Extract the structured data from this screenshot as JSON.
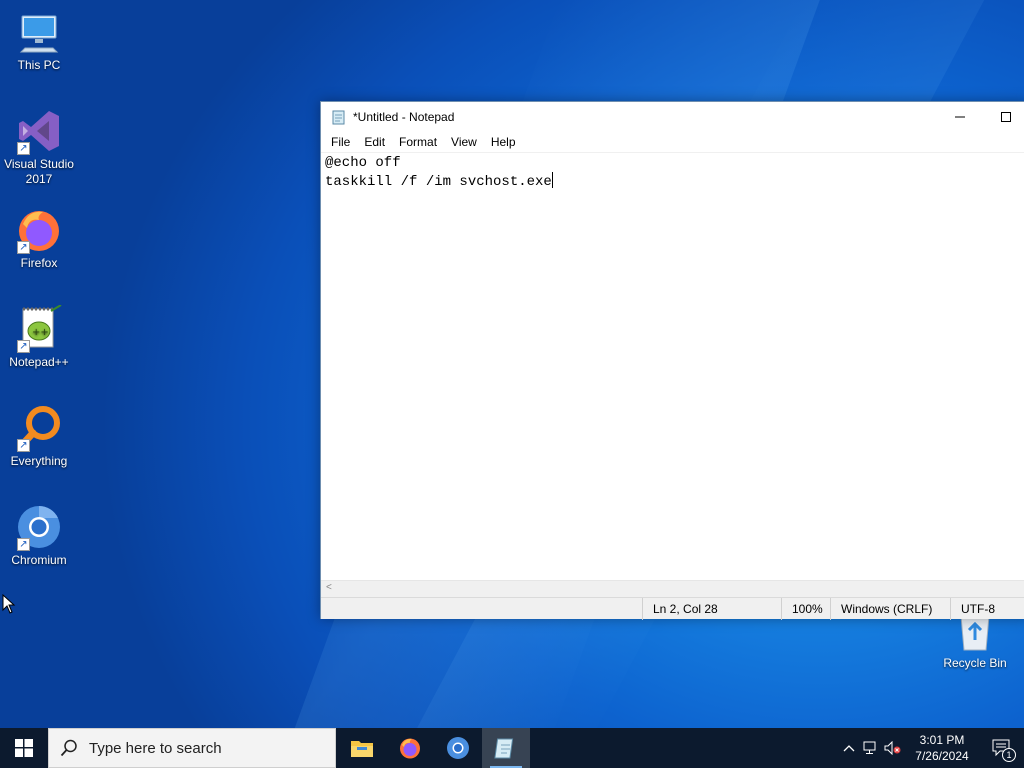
{
  "desktop": {
    "icons": [
      {
        "label": "This PC"
      },
      {
        "label": "Visual Studio 2017"
      },
      {
        "label": "Firefox"
      },
      {
        "label": "Notepad++"
      },
      {
        "label": "Everything"
      },
      {
        "label": "Chromium"
      },
      {
        "label": "Recycle Bin"
      }
    ]
  },
  "notepad": {
    "title": "*Untitled - Notepad",
    "menu": [
      "File",
      "Edit",
      "Format",
      "View",
      "Help"
    ],
    "lines": [
      "@echo off",
      "taskkill /f /im svchost.exe"
    ],
    "status": {
      "position": "Ln 2, Col 28",
      "zoom": "100%",
      "line_endings": "Windows (CRLF)",
      "encoding": "UTF-8"
    }
  },
  "taskbar": {
    "search_placeholder": "Type here to search",
    "apps": [
      "file-explorer",
      "firefox",
      "chromium",
      "notepad"
    ],
    "time": "3:01 PM",
    "date": "7/26/2024",
    "notification_count": "1"
  },
  "colors": {
    "desktop_blue": "#0d63cf",
    "taskbar": "#0c1a2e"
  }
}
